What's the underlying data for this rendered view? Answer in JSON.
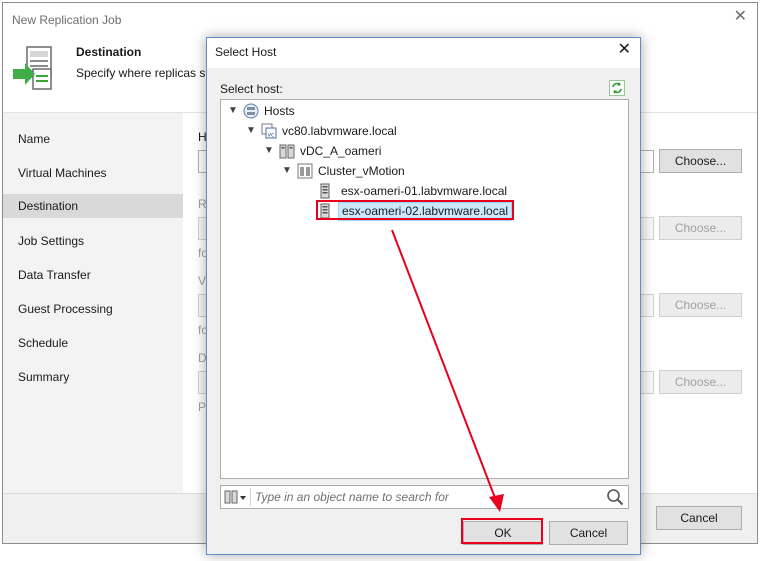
{
  "main_window": {
    "title": "New Replication Job",
    "header": {
      "title": "Destination",
      "description": "Specify where replicas sh"
    },
    "nav_items": [
      {
        "label": "Name",
        "active": false
      },
      {
        "label": "Virtual Machines",
        "active": false
      },
      {
        "label": "Destination",
        "active": true
      },
      {
        "label": "Job Settings",
        "active": false
      },
      {
        "label": "Data Transfer",
        "active": false
      },
      {
        "label": "Guest Processing",
        "active": false
      },
      {
        "label": "Schedule",
        "active": false
      },
      {
        "label": "Summary",
        "active": false
      }
    ],
    "content_labels": {
      "l1": "H",
      "l2": "R",
      "l3": "fo",
      "l4": "V",
      "l5": "fo",
      "l6": "D",
      "l7": "Pi"
    },
    "choose_label": "Choose...",
    "cancel_label": "Cancel"
  },
  "dialog": {
    "title": "Select Host",
    "select_label": "Select host:",
    "tree": {
      "root": "Hosts",
      "vcenter": "vc80.labvmware.local",
      "datacenter": "vDC_A_oameri",
      "cluster": "Cluster_vMotion",
      "host1": "esx-oameri-01.labvmware.local",
      "host2": "esx-oameri-02.labvmware.local"
    },
    "search_placeholder": "Type in an object name to search for",
    "ok_label": "OK",
    "cancel_label": "Cancel"
  },
  "colors": {
    "accent": "#0078d7",
    "selection_bg": "#cce8ff",
    "highlight_red": "#e8001c"
  }
}
